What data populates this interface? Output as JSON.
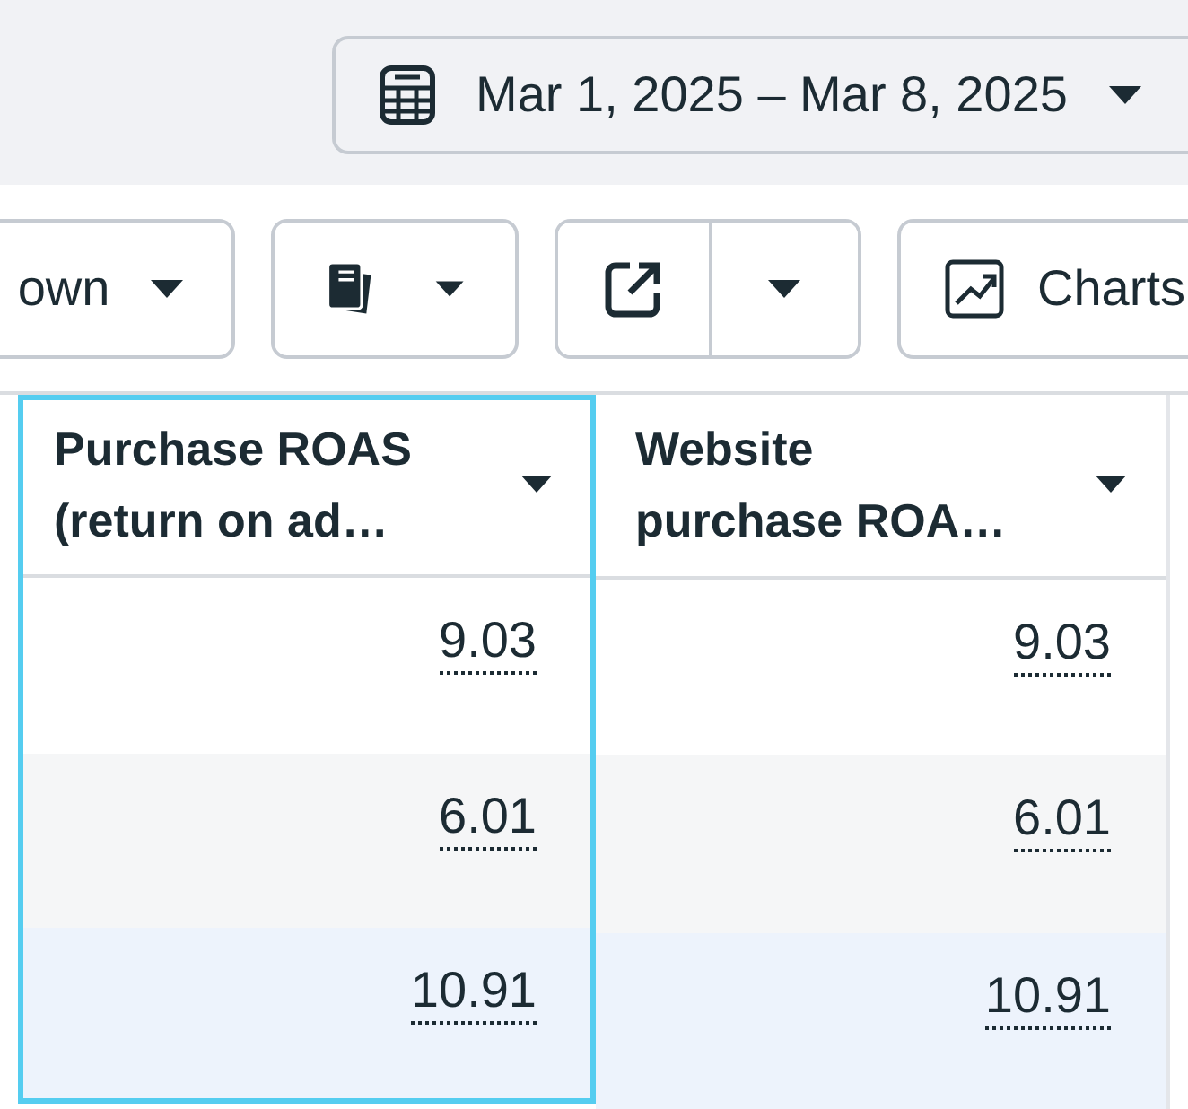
{
  "date_range": {
    "label": "Mar 1, 2025 – Mar 8, 2025"
  },
  "toolbar": [
    {
      "kind": "dropdown",
      "label": "own"
    },
    {
      "kind": "icon_dropdown"
    },
    {
      "kind": "split"
    },
    {
      "kind": "icon_label",
      "label": "Charts"
    }
  ],
  "table": {
    "columns": [
      {
        "header": "Purchase ROAS (return on ad…",
        "selected": true
      },
      {
        "header": "Website purchase ROA…",
        "selected": false
      }
    ],
    "rows": [
      {
        "cells": [
          "9.03",
          "9.03"
        ],
        "selected": false
      },
      {
        "cells": [
          "6.01",
          "6.01"
        ],
        "selected": false
      },
      {
        "cells": [
          "10.91",
          "10.91"
        ],
        "selected": true
      }
    ]
  }
}
